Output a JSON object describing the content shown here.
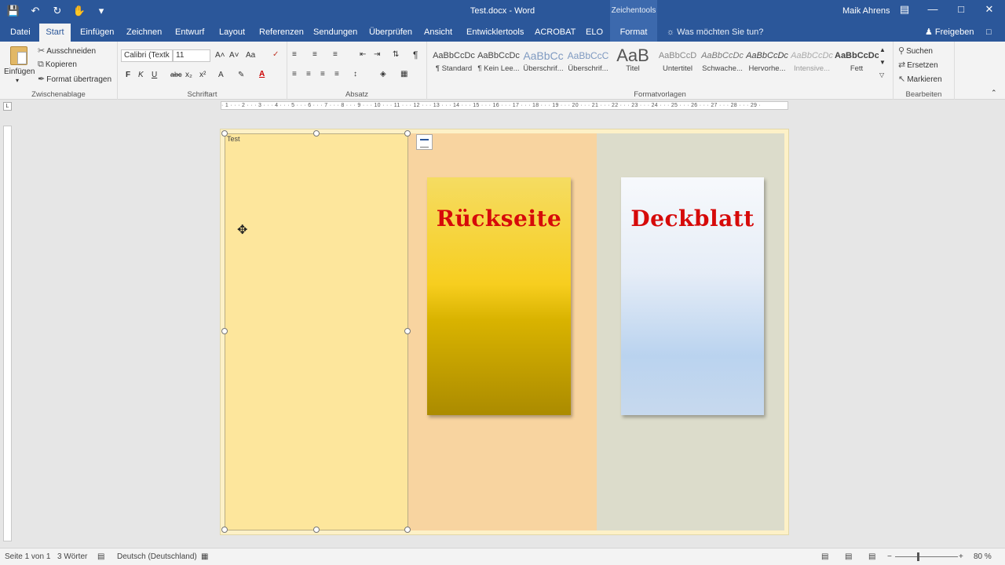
{
  "titlebar": {
    "document_title": "Test.docx  -  Word",
    "context_label": "Zeichentools",
    "user_name": "Maik Ahrens",
    "qat_icons": [
      "save-icon",
      "undo-icon",
      "redo-icon",
      "touch-mode-icon",
      "customize-icon"
    ]
  },
  "tabs": [
    "Datei",
    "Start",
    "Einfügen",
    "Zeichnen",
    "Entwurf",
    "Layout",
    "Referenzen",
    "Sendungen",
    "Überprüfen",
    "Ansicht",
    "Entwicklertools",
    "ACROBAT",
    "ELO",
    "Format"
  ],
  "active_tab": "Start",
  "tell_me": "Was möchten Sie tun?",
  "share_label": "Freigeben",
  "ribbon": {
    "clipboard": {
      "label": "Zwischenablage",
      "paste": "Einfügen",
      "cut": "Ausschneiden",
      "copy": "Kopieren",
      "format_painter": "Format übertragen"
    },
    "font": {
      "label": "Schriftart",
      "font_name": "Calibri (Textk",
      "font_size": "11",
      "bold": "F",
      "italic": "K",
      "underline": "U",
      "strike": "abc",
      "subscript": "x₂",
      "superscript": "x²",
      "grow": "A˄",
      "shrink": "A˅",
      "case": "Aa"
    },
    "paragraph": {
      "label": "Absatz",
      "pilcrow": "¶"
    },
    "styles": {
      "label": "Formatvorlagen",
      "items": [
        {
          "sample": "AaBbCcDc",
          "name": "¶ Standard"
        },
        {
          "sample": "AaBbCcDc",
          "name": "¶ Kein Lee..."
        },
        {
          "sample": "AaBbCc",
          "name": "Überschrif..."
        },
        {
          "sample": "AaBbCcC",
          "name": "Überschrif..."
        },
        {
          "sample": "AaB",
          "name": "Titel"
        },
        {
          "sample": "AaBbCcD",
          "name": "Untertitel"
        },
        {
          "sample": "AaBbCcDc",
          "name": "Schwache..."
        },
        {
          "sample": "AaBbCcDc",
          "name": "Hervorhe..."
        },
        {
          "sample": "AaBbCcDc",
          "name": "Intensive..."
        },
        {
          "sample": "AaBbCcDc",
          "name": "Fett"
        }
      ]
    },
    "editing": {
      "label": "Bearbeiten",
      "find": "Suchen",
      "replace": "Ersetzen",
      "select": "Markieren"
    }
  },
  "ruler": {
    "numbers": "· 1 · · · 2 · · · 3 · · · 4 · · · 5 · · · 6 · · · 7 · · · 8 · · · 9 · · · 10 · · · 11 · · · 12 · · · 13 · · · 14 · · · 15 · · · 16 · · · 17 · · · 18 · · · 19 · · · 20 · · · 21 · · · 22 · · · 23 · · · 24 · · · 25 · · · 26 · · · 27 · · · 28 · · · 29 ·",
    "corner": "L"
  },
  "document": {
    "anchor_text": "Test",
    "back_title": "Rückseite",
    "front_title": "Deckblatt",
    "colors": {
      "page": "#fdf1c7",
      "left_panel": "#fde69c",
      "mid_panel": "#f8d4a0",
      "right_panel": "#dcdccb",
      "title_red": "#d60a0a"
    }
  },
  "statusbar": {
    "page": "Seite 1 von 1",
    "words": "3 Wörter",
    "language": "Deutsch (Deutschland)",
    "zoom": "80 %"
  }
}
